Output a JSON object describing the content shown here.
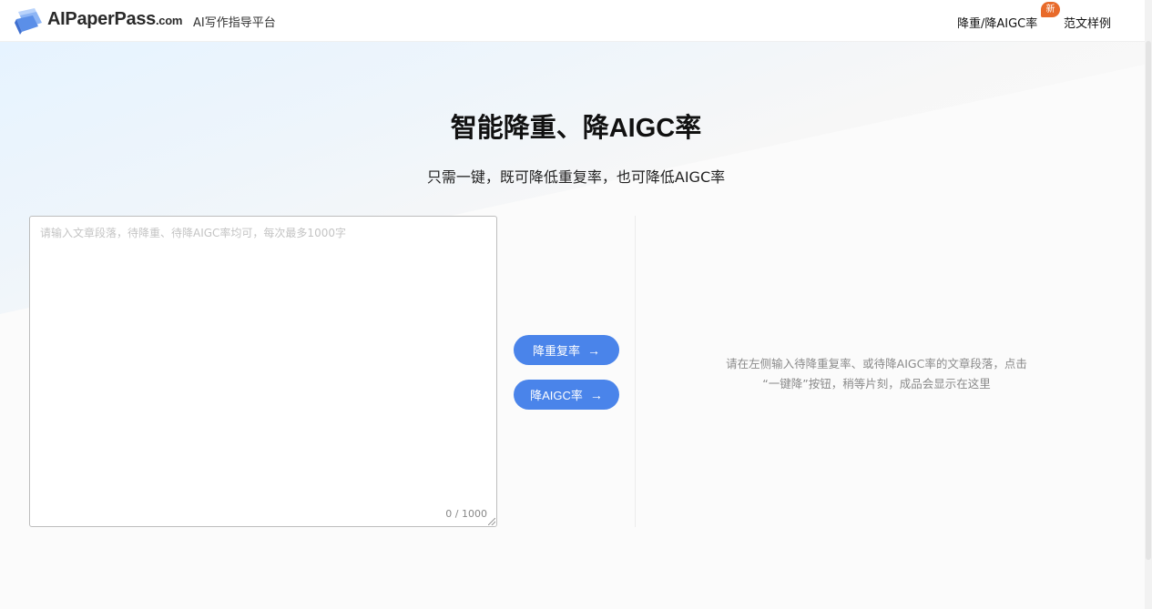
{
  "header": {
    "brand_main": "AIPaperPass",
    "brand_suffix": ".com",
    "tagline": "AI写作指导平台",
    "nav": [
      {
        "label": "降重/降AIGC率",
        "badge": "新"
      },
      {
        "label": "范文样例"
      }
    ]
  },
  "hero": {
    "title": "智能降重、降AIGC率",
    "subtitle": "只需一键，既可降低重复率，也可降低AIGC率"
  },
  "editor": {
    "placeholder": "请输入文章段落，待降重、待降AIGC率均可，每次最多1000字",
    "value": "",
    "counter": "0 / 1000"
  },
  "actions": {
    "reduce_dup_label": "降重复率",
    "reduce_aigc_label": "降AIGC率",
    "arrow": "→"
  },
  "output": {
    "hint_line1": "请在左侧输入待降重复率、或待降AIGC率的文章段落，点击",
    "hint_line2": "“一键降”按钮，稍等片刻，成品会显示在这里"
  },
  "colors": {
    "accent": "#4a84ea",
    "badge": "#e86a2a"
  }
}
